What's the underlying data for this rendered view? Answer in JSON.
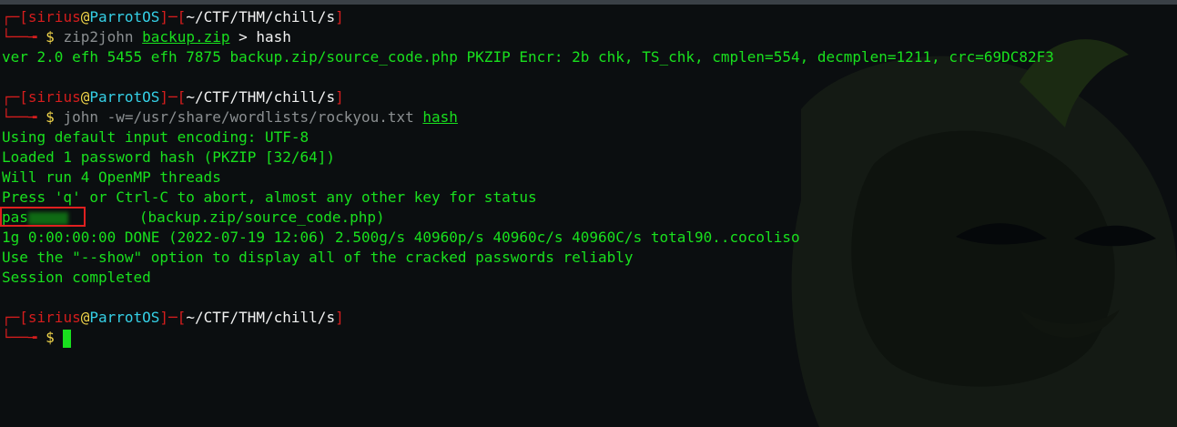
{
  "colors": {
    "background": "#0b0e10",
    "prompt_red": "#d51d1d",
    "host_cyan": "#35d0e6",
    "output_green": "#19e01e",
    "dollar_yellow": "#f1d54a",
    "highlight_red": "#e02020"
  },
  "prompt": {
    "user": "sirius",
    "at": "@",
    "host": "ParrotOS",
    "cwd": "~/CTF/THM/chill/s",
    "dollar": "$"
  },
  "block1": {
    "cmd": "zip2john",
    "arg": "backup.zip",
    "redirect": " > hash",
    "output": "ver 2.0 efh 5455 efh 7875 backup.zip/source_code.php PKZIP Encr: 2b chk, TS_chk, cmplen=554, decmplen=1211, crc=69DC82F3"
  },
  "block2": {
    "cmd": "john",
    "opt": " -w=/usr/share/wordlists/rockyou.txt ",
    "arg": "hash",
    "lines": [
      "Using default input encoding: UTF-8",
      "Loaded 1 password hash (PKZIP [32/64])",
      "Will run 4 OpenMP threads",
      "Press 'q' or Ctrl-C to abort, almost any other key for status"
    ],
    "cracked_prefix": "pas",
    "cracked_file": "(backup.zip/source_code.php)",
    "after": [
      "1g 0:00:00:00 DONE (2022-07-19 12:06) 2.500g/s 40960p/s 40960c/s 40960C/s total90..cocoliso",
      "Use the \"--show\" option to display all of the cracked passwords reliably",
      "Session completed"
    ]
  }
}
